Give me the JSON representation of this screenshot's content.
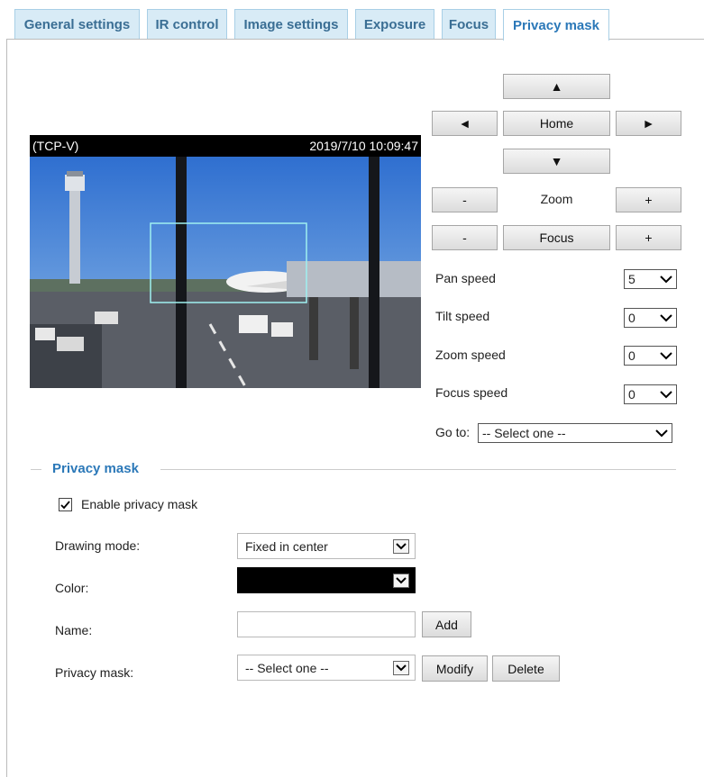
{
  "tabs": [
    {
      "label": "General settings"
    },
    {
      "label": "IR control"
    },
    {
      "label": "Image settings"
    },
    {
      "label": "Exposure"
    },
    {
      "label": "Focus"
    },
    {
      "label": "Privacy mask",
      "active": true
    }
  ],
  "video": {
    "stream_label": "(TCP-V)",
    "timestamp": "2019/7/10 10:09:47"
  },
  "ptz": {
    "up_icon": "▲",
    "left_icon": "◄",
    "home_label": "Home",
    "right_icon": "►",
    "down_icon": "▼",
    "zoom_minus": "-",
    "zoom_label": "Zoom",
    "zoom_plus": "+",
    "focus_minus": "-",
    "focus_label": "Focus",
    "focus_plus": "+",
    "pan_speed_label": "Pan speed",
    "pan_speed_value": "5",
    "tilt_speed_label": "Tilt speed",
    "tilt_speed_value": "0",
    "zoom_speed_label": "Zoom speed",
    "zoom_speed_value": "0",
    "focus_speed_label": "Focus speed",
    "focus_speed_value": "0",
    "goto_label": "Go to:",
    "goto_value": "-- Select one --"
  },
  "privacy": {
    "section_title": "Privacy mask",
    "enable_label": "Enable privacy mask",
    "enabled": true,
    "drawing_mode_label": "Drawing mode:",
    "drawing_mode_value": "Fixed in center",
    "color_label": "Color:",
    "color_value": "#000000",
    "name_label": "Name:",
    "name_value": "",
    "add_label": "Add",
    "mask_label": "Privacy mask:",
    "mask_value": "-- Select one --",
    "modify_label": "Modify",
    "delete_label": "Delete"
  }
}
